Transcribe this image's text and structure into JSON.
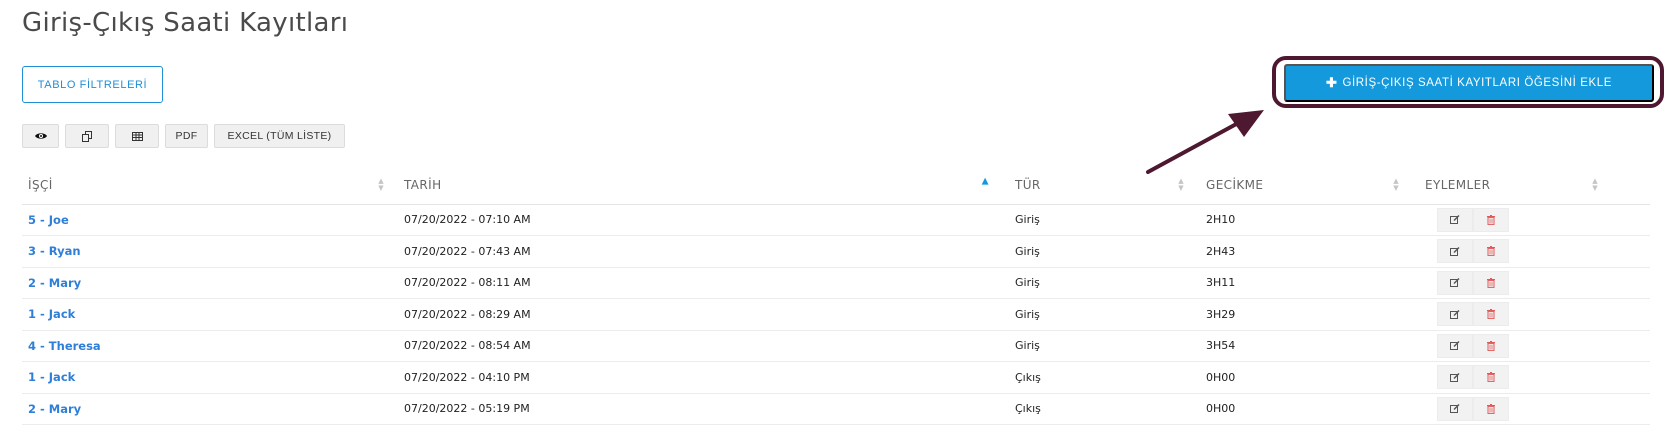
{
  "page": {
    "title": "Giriş-Çıkış Saati Kayıtları"
  },
  "buttons": {
    "filters": "TABLO FİLTRELERİ",
    "add": "GİRİŞ-ÇIKIŞ SAATİ KAYITLARI ÖĞESİNİ EKLE",
    "add_icon": "plus-icon"
  },
  "toolbar": {
    "view_icon": "eye-icon",
    "copy_icon": "copy-icon",
    "csv_icon": "table-icon",
    "pdf": "PDF",
    "excel": "EXCEL (TÜM LİSTE)"
  },
  "table": {
    "headers": {
      "worker": "İŞÇİ",
      "date": "TARİH",
      "type": "TÜR",
      "delay": "GECİKME",
      "actions": "EYLEMLER"
    },
    "sorted_column": "date",
    "sort_direction": "asc",
    "rows": [
      {
        "worker": "5 - Joe",
        "date": "07/20/2022 - 07:10 AM",
        "type": "Giriş",
        "delay": "2H10"
      },
      {
        "worker": "3 - Ryan",
        "date": "07/20/2022 - 07:43 AM",
        "type": "Giriş",
        "delay": "2H43"
      },
      {
        "worker": "2 - Mary",
        "date": "07/20/2022 - 08:11 AM",
        "type": "Giriş",
        "delay": "3H11"
      },
      {
        "worker": "1 - Jack",
        "date": "07/20/2022 - 08:29 AM",
        "type": "Giriş",
        "delay": "3H29"
      },
      {
        "worker": "4 - Theresa",
        "date": "07/20/2022 - 08:54 AM",
        "type": "Giriş",
        "delay": "3H54"
      },
      {
        "worker": "1 - Jack",
        "date": "07/20/2022 - 04:10 PM",
        "type": "Çıkış",
        "delay": "0H00"
      },
      {
        "worker": "2 - Mary",
        "date": "07/20/2022 - 05:19 PM",
        "type": "Çıkış",
        "delay": "0H00"
      }
    ],
    "row_action_icons": [
      "edit-icon",
      "trash-icon"
    ]
  },
  "colors": {
    "accent": "#1499dc",
    "link": "#2f7fd8",
    "annotation": "#4d1830",
    "delete": "#e05a5a"
  }
}
